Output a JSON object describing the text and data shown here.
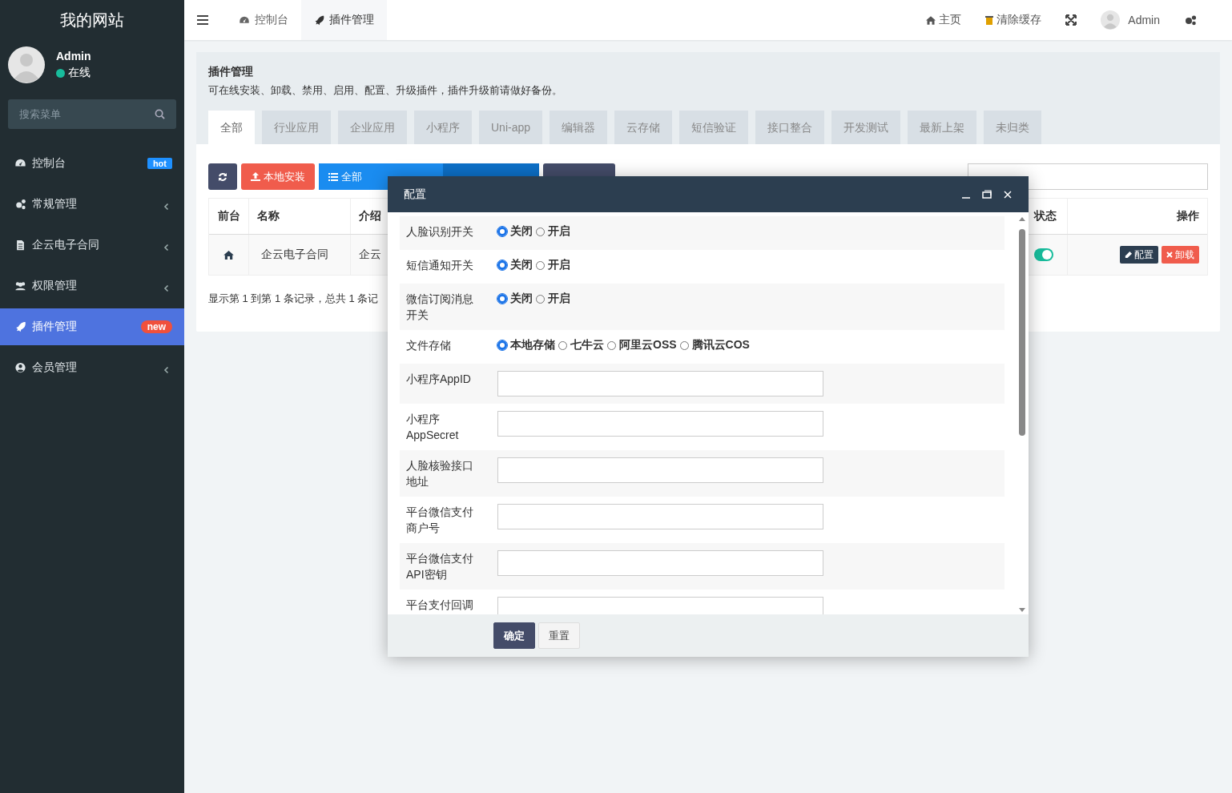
{
  "sidebar": {
    "brand": "我的网站",
    "user": {
      "name": "Admin",
      "status": "在线"
    },
    "search": {
      "placeholder": "搜索菜单"
    },
    "items": [
      {
        "label": "控制台",
        "badge": "hot",
        "color": "#1e90ff",
        "expandable": false,
        "selected": false
      },
      {
        "label": "常规管理",
        "expandable": true,
        "selected": false
      },
      {
        "label": "企云电子合同",
        "expandable": true,
        "selected": false
      },
      {
        "label": "权限管理",
        "expandable": true,
        "selected": false
      },
      {
        "label": "插件管理",
        "badge": "new",
        "color": "#f0503c",
        "expandable": false,
        "selected": true
      },
      {
        "label": "会员管理",
        "expandable": true,
        "selected": false
      }
    ]
  },
  "topbar": {
    "tabs": [
      {
        "label": "控制台",
        "selected": false
      },
      {
        "label": "插件管理",
        "selected": true
      }
    ],
    "links": [
      "主页",
      "清除缓存"
    ],
    "user": "Admin"
  },
  "panel": {
    "title": "插件管理",
    "description": "可在线安装、卸载、禁用、启用、配置、升级插件，插件升级前请做好备份。",
    "categories": [
      {
        "label": "全部",
        "selected": true
      },
      {
        "label": "行业应用",
        "selected": false
      },
      {
        "label": "企业应用",
        "selected": false
      },
      {
        "label": "小程序",
        "selected": false
      },
      {
        "label": "Uni-app",
        "selected": false
      },
      {
        "label": "编辑器",
        "selected": false
      },
      {
        "label": "云存储",
        "selected": false
      },
      {
        "label": "短信验证",
        "selected": false
      },
      {
        "label": "接口整合",
        "selected": false
      },
      {
        "label": "开发测试",
        "selected": false
      },
      {
        "label": "最新上架",
        "selected": false
      },
      {
        "label": "未归类",
        "selected": false
      }
    ],
    "install_button": "本地安装",
    "filter_button": "全部",
    "table": {
      "columns": [
        "前台",
        "名称",
        "介绍",
        "状态",
        "操作"
      ],
      "rows": [
        {
          "name": "企云电子合同",
          "intro": "企云",
          "enabled": true,
          "actions": [
            "配置",
            "卸载"
          ]
        }
      ]
    },
    "pagination": "显示第 1 到第 1 条记录，总共 1 条记"
  },
  "dialog": {
    "title": "配置",
    "fields": [
      {
        "kind": "radio",
        "label": "人脸识别开关",
        "options": [
          {
            "label": "关闭",
            "selected": true
          },
          {
            "label": "开启",
            "selected": false
          }
        ]
      },
      {
        "kind": "radio",
        "label": "短信通知开关",
        "options": [
          {
            "label": "关闭",
            "selected": true
          },
          {
            "label": "开启",
            "selected": false
          }
        ]
      },
      {
        "kind": "radio",
        "label": "微信订阅消息开关",
        "options": [
          {
            "label": "关闭",
            "selected": true
          },
          {
            "label": "开启",
            "selected": false
          }
        ]
      },
      {
        "kind": "radio",
        "label": "文件存储",
        "options": [
          {
            "label": "本地存储",
            "selected": true
          },
          {
            "label": "七牛云",
            "selected": false
          },
          {
            "label": "阿里云OSS",
            "selected": false
          },
          {
            "label": "腾讯云COS",
            "selected": false
          }
        ]
      },
      {
        "kind": "text",
        "label": "小程序AppID"
      },
      {
        "kind": "text",
        "label": "小程序AppSecret"
      },
      {
        "kind": "text",
        "label": "人脸核验接口地址"
      },
      {
        "kind": "text",
        "label": "平台微信支付商户号"
      },
      {
        "kind": "text",
        "label": "平台微信支付API密钥"
      },
      {
        "kind": "text",
        "label": "平台支付回调"
      }
    ],
    "buttons": [
      {
        "label": "确定",
        "kind": "primary"
      },
      {
        "label": "重置",
        "kind": "default"
      }
    ]
  }
}
